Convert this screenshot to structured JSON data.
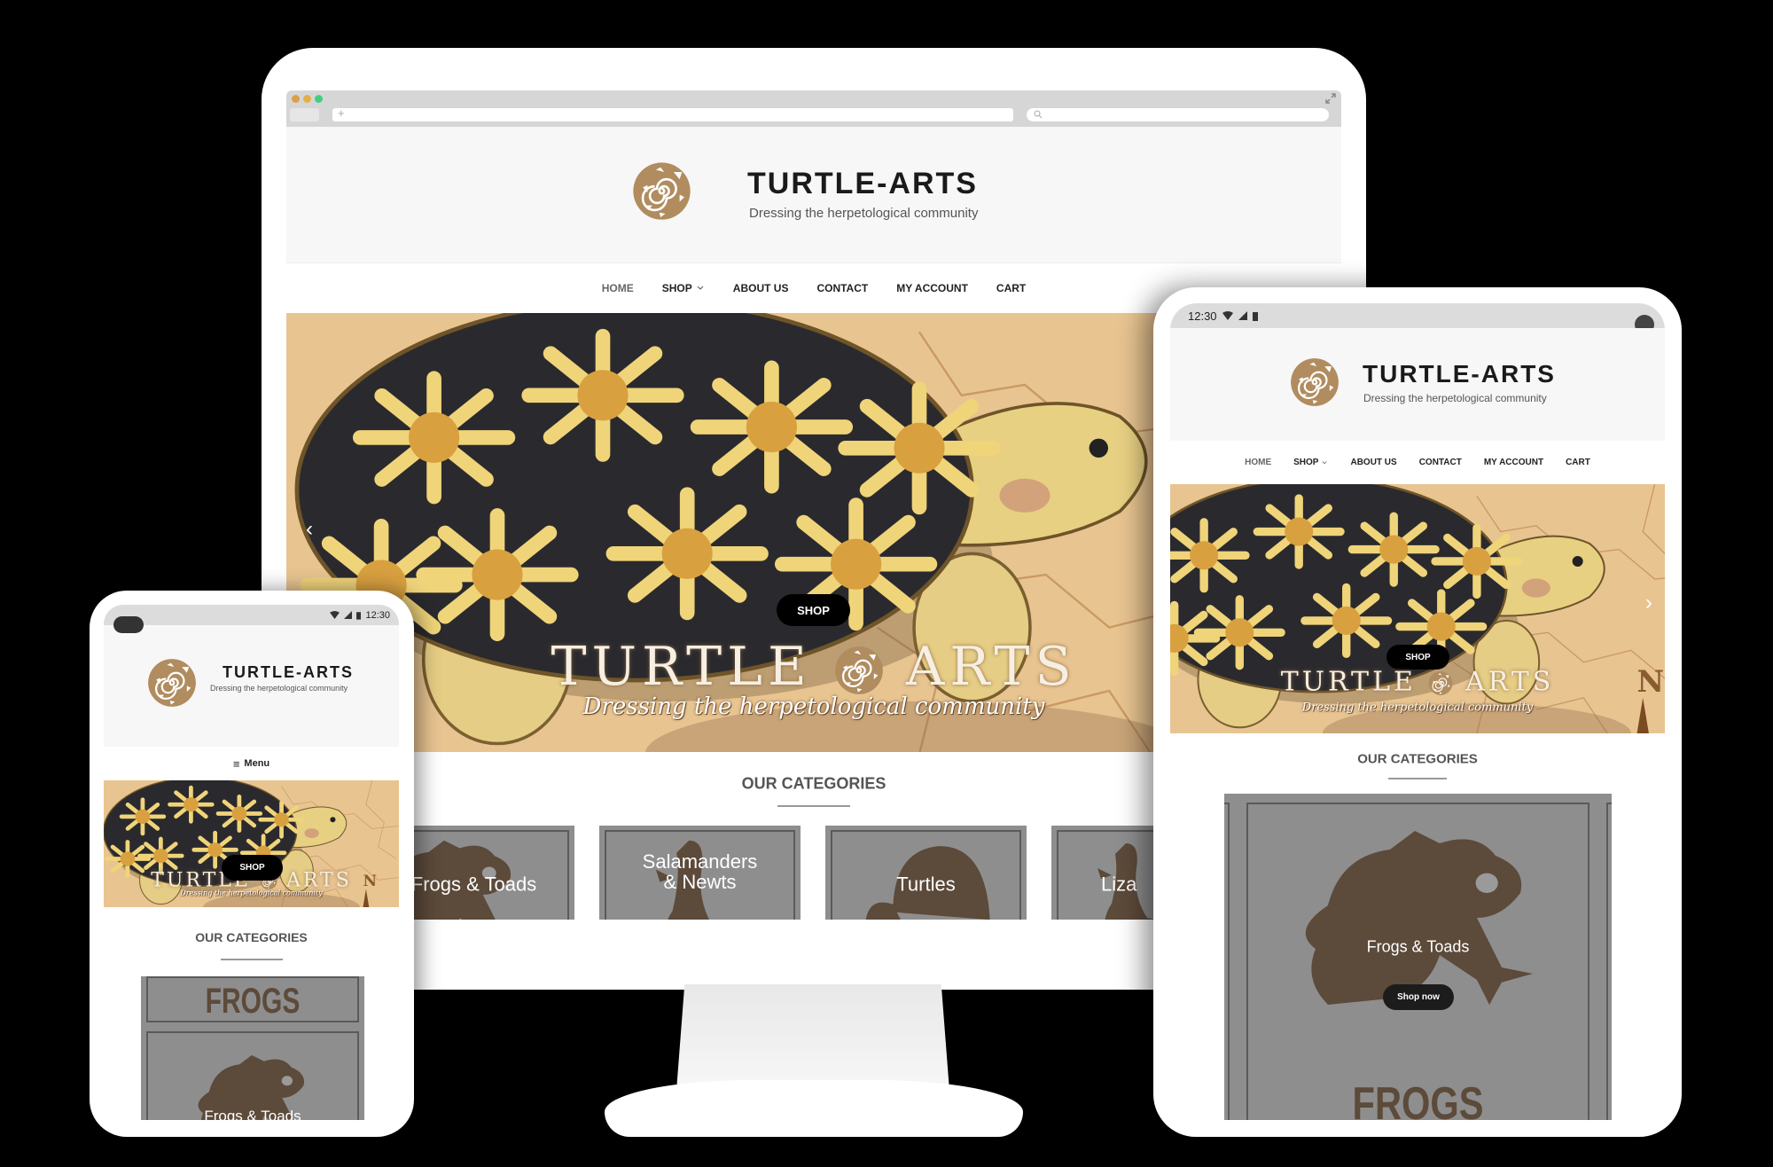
{
  "site": {
    "title": "TURTLE-ARTS",
    "tagline": "Dressing the herpetological community",
    "nav": [
      "HOME",
      "SHOP",
      "ABOUT US",
      "CONTACT",
      "MY ACCOUNT",
      "CART"
    ],
    "menu_label": "Menu",
    "hero": {
      "title_left": "TURTLE",
      "title_right": "ARTS",
      "tagline": "Dressing the herpetological community",
      "shop_label": "SHOP"
    },
    "categories_title": "OUR CATEGORIES",
    "categories": [
      "Frogs & Toads",
      "Salamanders & Newts",
      "Turtles",
      "Liza"
    ],
    "shop_now_label": "Shop now",
    "frogs_sign": "FROGS"
  },
  "devices": {
    "status_time": "12:30"
  },
  "icons": {
    "logo": "spiral-turtle-logo",
    "nav_shop": "chevron-down-icon",
    "menu": "hamburger-icon",
    "wifi": "wifi-icon",
    "signal": "signal-icon",
    "battery": "battery-icon",
    "search": "search-icon"
  },
  "colors": {
    "brand_tan": "#b08c5f",
    "hero_map": "#e8c491",
    "card_gray": "#8e8e8e",
    "silhouette_brown": "#5c4a3a",
    "button_black": "#000000",
    "traffic_red": "#d9a04a",
    "traffic_yellow": "#e2b04a",
    "traffic_green": "#3fd07f"
  }
}
